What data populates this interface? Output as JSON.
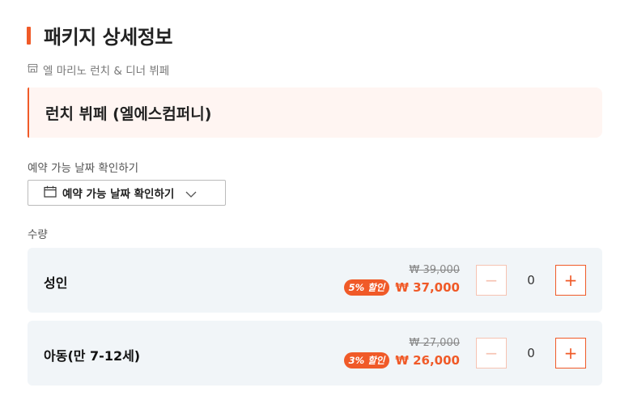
{
  "header": {
    "title": "패키지 상세정보"
  },
  "store": {
    "icon": "store-icon",
    "name": "엘 마리노 런치 & 디너 뷔페"
  },
  "product": {
    "name": "런치 뷔페 (엘에스컴퍼니)"
  },
  "date": {
    "label": "예약 가능 날짜 확인하기",
    "button_label": "예약 가능 날짜 확인하기"
  },
  "quantity": {
    "label": "수량",
    "rows": [
      {
        "name": "성인",
        "original_price": "₩ 39,000",
        "discount": "5% 할인",
        "sale_price": "₩ 37,000",
        "count": "0",
        "minus": "−",
        "plus": "+"
      },
      {
        "name": "아동(만 7-12세)",
        "original_price": "₩ 27,000",
        "discount": "3% 할인",
        "sale_price": "₩ 26,000",
        "count": "0",
        "minus": "−",
        "plus": "+"
      }
    ]
  },
  "colors": {
    "accent": "#f05a28",
    "row_bg": "#f1f5f8",
    "product_bg": "#fff5f2"
  }
}
